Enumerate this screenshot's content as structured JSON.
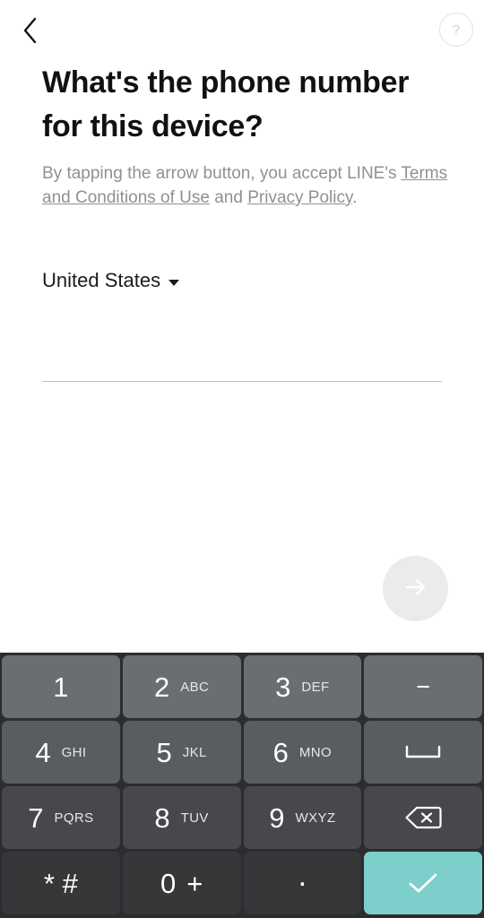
{
  "topbar": {
    "back_icon": "chevron-left-icon",
    "help_label": "?",
    "help_icon": "question-mark-icon"
  },
  "page": {
    "title": "What's the phone number for this device?",
    "legal_prefix": "By tapping the arrow button, you accept LINE's ",
    "terms_link": "Terms and Conditions of Use",
    "legal_conjunction": " and ",
    "privacy_link": "Privacy Policy",
    "legal_suffix": "."
  },
  "country": {
    "selected": "United States",
    "caret_icon": "caret-down-icon"
  },
  "phone_input": {
    "value": "",
    "placeholder": ""
  },
  "submit": {
    "icon": "arrow-right-icon",
    "enabled": false,
    "background": "#ebebeb"
  },
  "keypad": {
    "background": "#2b2d30",
    "enter_color": "#7ccfca",
    "rows": [
      [
        {
          "digit": "1",
          "letters": "",
          "name": "key-1"
        },
        {
          "digit": "2",
          "letters": "ABC",
          "name": "key-2"
        },
        {
          "digit": "3",
          "letters": "DEF",
          "name": "key-3"
        },
        {
          "digit": "",
          "letters": "",
          "sym": "−",
          "name": "key-dash"
        }
      ],
      [
        {
          "digit": "4",
          "letters": "GHI",
          "name": "key-4"
        },
        {
          "digit": "5",
          "letters": "JKL",
          "name": "key-5"
        },
        {
          "digit": "6",
          "letters": "MNO",
          "name": "key-6"
        },
        {
          "digit": "",
          "letters": "",
          "sym": "space",
          "name": "key-space"
        }
      ],
      [
        {
          "digit": "7",
          "letters": "PQRS",
          "name": "key-7"
        },
        {
          "digit": "8",
          "letters": "TUV",
          "name": "key-8"
        },
        {
          "digit": "9",
          "letters": "WXYZ",
          "name": "key-9"
        },
        {
          "digit": "",
          "letters": "",
          "sym": "backspace",
          "name": "key-backspace"
        }
      ],
      [
        {
          "digit": "* #",
          "letters": "",
          "name": "key-star-hash"
        },
        {
          "digit": "0",
          "letters": "+",
          "name": "key-0"
        },
        {
          "digit": ".",
          "letters": "",
          "name": "key-period"
        },
        {
          "digit": "",
          "letters": "",
          "sym": "check",
          "name": "key-enter"
        }
      ]
    ],
    "labels": {
      "k1": "1",
      "k1l": "",
      "k2": "2",
      "k2l": "ABC",
      "k3": "3",
      "k3l": "DEF",
      "kdash": "−",
      "k4": "4",
      "k4l": "GHI",
      "k5": "5",
      "k5l": "JKL",
      "k6": "6",
      "k6l": "MNO",
      "k7": "7",
      "k7l": "PQRS",
      "k8": "8",
      "k8l": "TUV",
      "k9": "9",
      "k9l": "WXYZ",
      "kstar": "* #",
      "k0": "0",
      "k0l": "+",
      "kdot": "."
    }
  }
}
